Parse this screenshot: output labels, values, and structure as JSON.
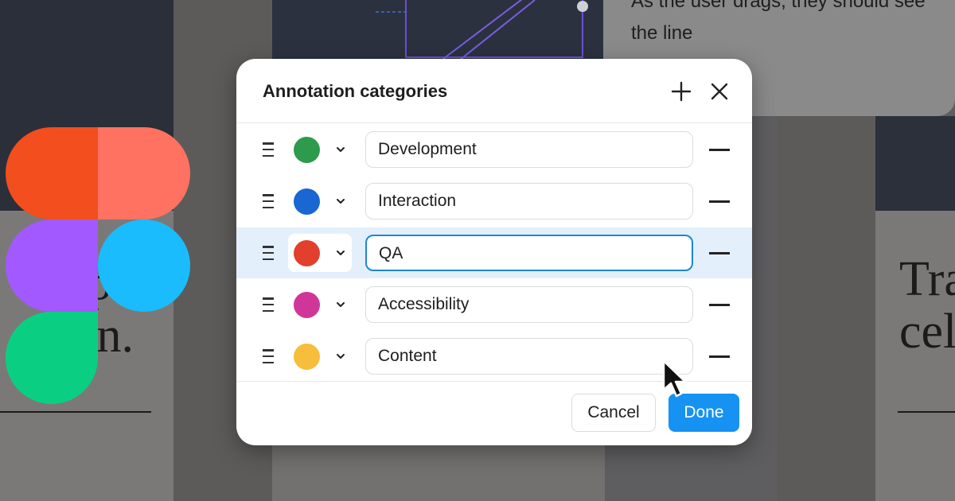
{
  "background": {
    "note_text": "As the user drags, they should see the line",
    "left_card_text": "pe\nh n.",
    "right_card_text": "Tra\ncele"
  },
  "dialog": {
    "title": "Annotation categories",
    "add_icon": "plus-icon",
    "close_icon": "close-icon",
    "categories": [
      {
        "name": "Development",
        "color": "#2e9a4c",
        "selected": false
      },
      {
        "name": "Interaction",
        "color": "#1a66d2",
        "selected": false
      },
      {
        "name": "QA",
        "color": "#e23f2c",
        "selected": true
      },
      {
        "name": "Accessibility",
        "color": "#d03699",
        "selected": false
      },
      {
        "name": "Content",
        "color": "#f6be3b",
        "selected": false
      }
    ],
    "cancel_label": "Cancel",
    "done_label": "Done"
  },
  "colors": {
    "accent": "#1592f2",
    "selected_row": "#e3f0fb",
    "focus_border": "#1e86d6"
  },
  "logo": {
    "name": "figma-logo",
    "colors": [
      "#f24e1e",
      "#ff7262",
      "#a259ff",
      "#1abcfe",
      "#0acf83"
    ]
  }
}
